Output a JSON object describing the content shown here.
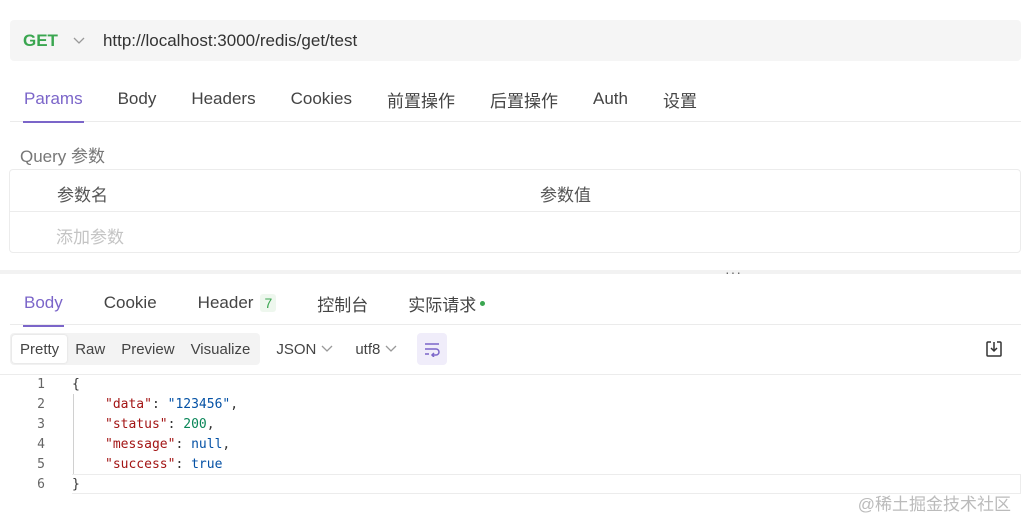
{
  "request": {
    "method": "GET",
    "url": "http://localhost:3000/redis/get/test"
  },
  "request_tabs": [
    {
      "label": "Params",
      "active": true
    },
    {
      "label": "Body",
      "active": false
    },
    {
      "label": "Headers",
      "active": false
    },
    {
      "label": "Cookies",
      "active": false
    },
    {
      "label": "前置操作",
      "active": false
    },
    {
      "label": "后置操作",
      "active": false
    },
    {
      "label": "Auth",
      "active": false
    },
    {
      "label": "设置",
      "active": false
    }
  ],
  "query": {
    "label": "Query 参数",
    "col_name": "参数名",
    "col_value": "参数值",
    "add_placeholder": "添加参数"
  },
  "response_tabs": {
    "body": "Body",
    "cookie": "Cookie",
    "header": "Header",
    "header_count": "7",
    "console": "控制台",
    "actual_request": "实际请求"
  },
  "view_modes": [
    "Pretty",
    "Raw",
    "Preview",
    "Visualize"
  ],
  "format": "JSON",
  "encoding": "utf8",
  "code_lines": [
    "1",
    "2",
    "3",
    "4",
    "5",
    "6"
  ],
  "response_body": {
    "open": "{",
    "data_key": "\"data\"",
    "data_val": "\"123456\"",
    "status_key": "\"status\"",
    "status_val": "200",
    "message_key": "\"message\"",
    "message_val": "null",
    "success_key": "\"success\"",
    "success_val": "true",
    "close": "}"
  },
  "watermark": "@稀土掘金技术社区",
  "colors": {
    "accent": "#7b65c9",
    "method_get": "#3aa650"
  }
}
